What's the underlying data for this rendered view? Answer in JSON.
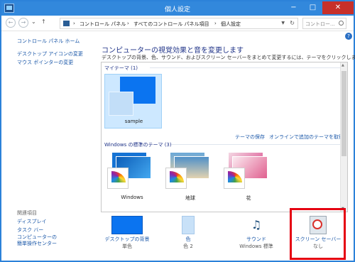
{
  "window": {
    "title": "個人設定",
    "controls": {
      "minimize": "−",
      "maximize": "□",
      "close": "✕"
    }
  },
  "nav": {
    "back": "←",
    "forward": "→",
    "recent": "⌄",
    "up": "↑",
    "breadcrumbs": [
      "コントロール パネル",
      "すべてのコントロール パネル項目",
      "個人設定"
    ],
    "separator": "›",
    "refresh": "↻",
    "search_placeholder": "コントロー...",
    "help": "?"
  },
  "sidebar": {
    "home": "コントロール パネル ホーム",
    "links": [
      "デスクトップ アイコンの変更",
      "マウス ポインターの変更"
    ],
    "related_heading": "関連項目",
    "related": [
      "ディスプレイ",
      "タスク バー",
      "コンピューターの",
      "簡単操作センター"
    ]
  },
  "main": {
    "heading": "コンピューターの視覚効果と音を変更します",
    "subtext": "デスクトップの背景、色、サウンド、およびスクリーン セーバーをまとめて変更するには、テーマをクリックします。"
  },
  "themes": {
    "my_themes_header": "マイテーマ (1)",
    "my_theme_name": "sample",
    "save_link": "テーマの保存",
    "online_link": "オンラインで追加のテーマを取得",
    "windows_header": "Windows の標準のテーマ (3)",
    "windows_themes": [
      {
        "name": "Windows"
      },
      {
        "name": "地球"
      },
      {
        "name": "花"
      }
    ]
  },
  "bottom": {
    "background": {
      "label": "デスクトップの背景",
      "value": "単色"
    },
    "color": {
      "label": "色",
      "value": "色 2"
    },
    "sound": {
      "label": "サウンド",
      "value": "Windows 標準"
    },
    "screensaver": {
      "label": "スクリーン セーバー",
      "value": "なし"
    }
  },
  "colors": {
    "accent": "#3288dc",
    "highlight": "#e50012",
    "link": "#1a57a8",
    "heading": "#1e3287"
  }
}
